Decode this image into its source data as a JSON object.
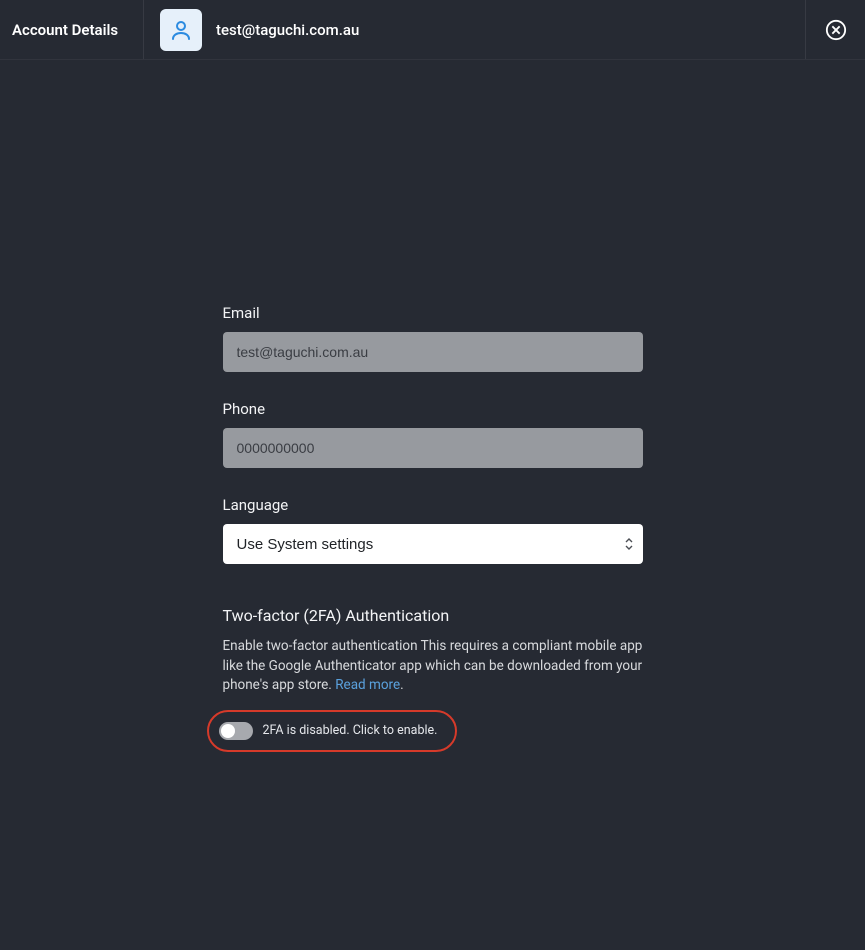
{
  "header": {
    "title": "Account Details",
    "email": "test@taguchi.com.au"
  },
  "form": {
    "email": {
      "label": "Email",
      "value": "test@taguchi.com.au"
    },
    "phone": {
      "label": "Phone",
      "placeholder": "0000000000",
      "value": ""
    },
    "language": {
      "label": "Language",
      "selected": "Use System settings"
    },
    "twofa": {
      "title": "Two-factor (2FA) Authentication",
      "desc_part1": "Enable two-factor authentication This requires a compliant mobile app like the Google Authenticator app which can be downloaded from your phone's app store. ",
      "read_more": "Read more",
      "desc_part2": ".",
      "toggle_label": "2FA is disabled. Click to enable."
    }
  }
}
